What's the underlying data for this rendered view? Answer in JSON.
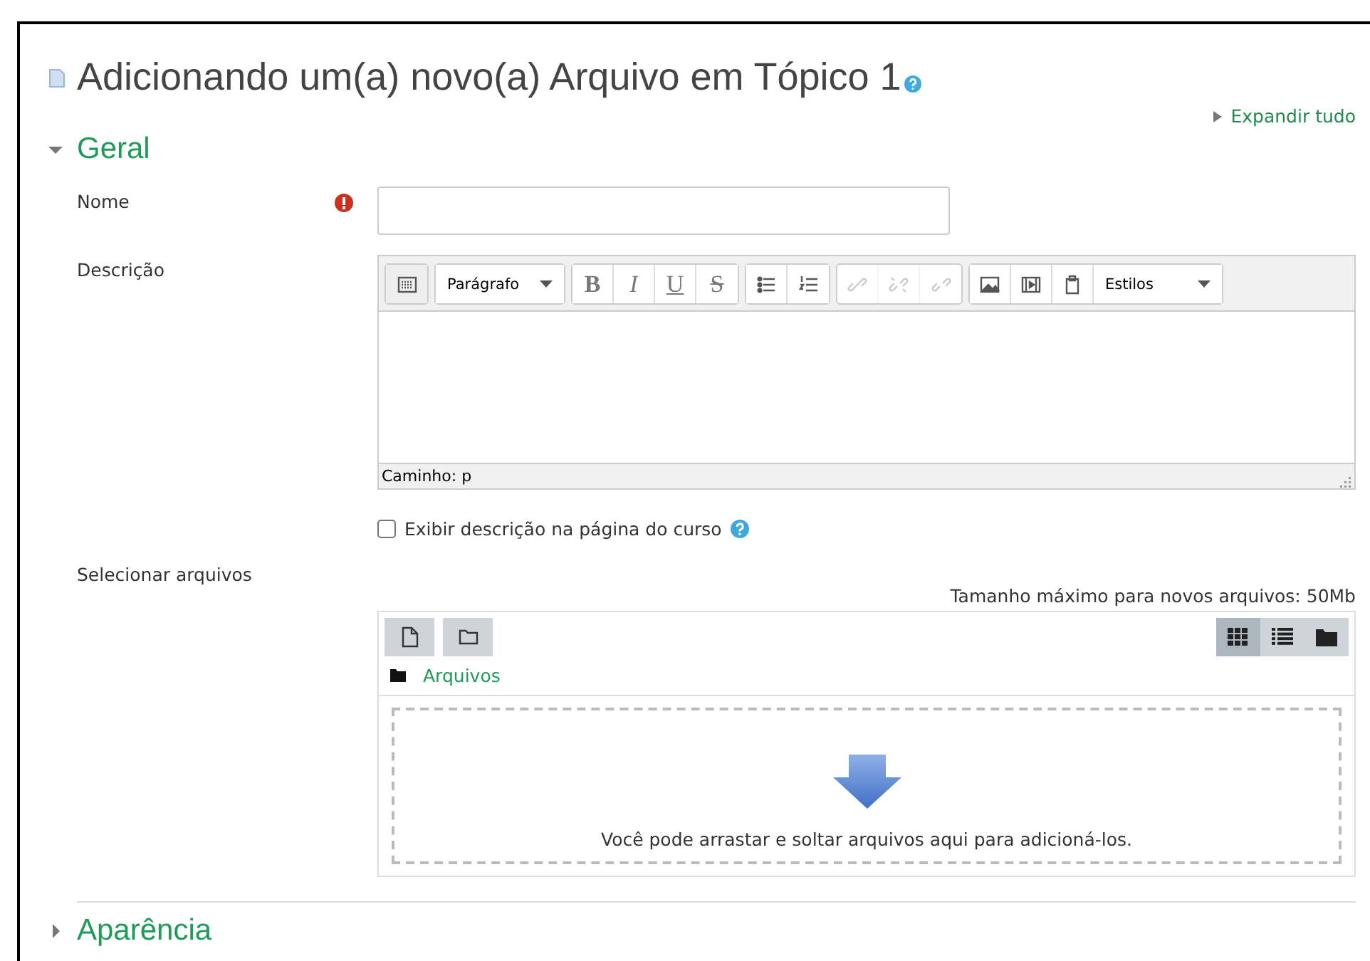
{
  "title": "Adicionando um(a) novo(a) Arquivo em Tópico 1",
  "expand_all": "Expandir tudo",
  "sections": [
    {
      "title": "Geral",
      "expanded": true
    },
    {
      "title": "Aparência",
      "expanded": false
    }
  ],
  "name_field": {
    "label": "Nome",
    "required": true
  },
  "description": {
    "label": "Descrição",
    "toolbar": [
      [
        {
          "kind": "toggle",
          "disabled": false
        }
      ],
      [
        {
          "kind": "select",
          "label": "Parágrafo",
          "disabled": false
        }
      ],
      [
        {
          "kind": "bold",
          "glyph": "B",
          "disabled": false
        },
        {
          "kind": "italic",
          "glyph": "I",
          "disabled": false
        },
        {
          "kind": "underline",
          "glyph": "U",
          "disabled": false
        },
        {
          "kind": "strike",
          "glyph": "S",
          "disabled": false
        }
      ],
      [
        {
          "kind": "bullets",
          "disabled": false
        },
        {
          "kind": "numbers",
          "disabled": false
        }
      ],
      [
        {
          "kind": "link",
          "disabled": true
        },
        {
          "kind": "unlink",
          "disabled": true
        },
        {
          "kind": "anchor",
          "disabled": true
        }
      ],
      [
        {
          "kind": "image",
          "disabled": false
        },
        {
          "kind": "media",
          "disabled": false
        },
        {
          "kind": "clipboard",
          "disabled": false
        },
        {
          "kind": "select",
          "label": "Estilos",
          "disabled": false
        }
      ]
    ],
    "path": "Caminho: p"
  },
  "show_description": {
    "label": "Exibir descrição na página do curso",
    "checked": false
  },
  "files": {
    "label": "Selecionar arquivos",
    "max_size": "Tamanho máximo para novos arquivos: 50Mb",
    "actions": [
      {
        "kind": "file"
      },
      {
        "kind": "folder"
      }
    ],
    "views": [
      {
        "kind": "grid",
        "selected": true
      },
      {
        "kind": "list",
        "selected": false
      },
      {
        "kind": "tree",
        "selected": false
      }
    ],
    "breadcrumb": "Arquivos",
    "drop_text": "Você pode arrastar e soltar arquivos aqui para adicioná-los."
  }
}
